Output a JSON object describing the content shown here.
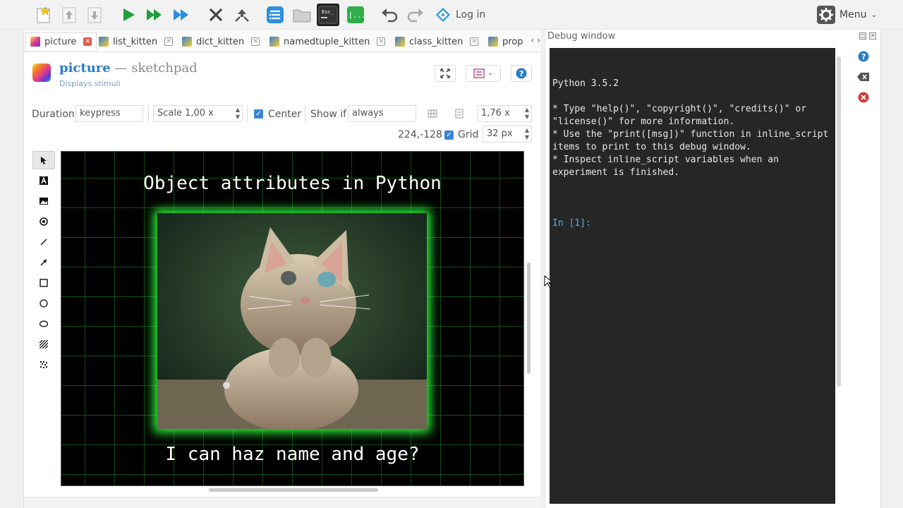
{
  "toolbar": {
    "login_label": "Log in",
    "menu_label": "Menu",
    "console_icon_text": "Esc_",
    "var_icon_text": "[...]"
  },
  "tabs": [
    {
      "label": "picture",
      "active": true
    },
    {
      "label": "list_kitten"
    },
    {
      "label": "dict_kitten"
    },
    {
      "label": "namedtuple_kitten"
    },
    {
      "label": "class_kitten"
    },
    {
      "label": "prop"
    }
  ],
  "item": {
    "name": "picture",
    "separator": "—",
    "type": "sketchpad",
    "description": "Displays stimuli"
  },
  "controls": {
    "duration_label": "Duration",
    "duration_value": "keypress",
    "scale_value": "Scale 1,00 x",
    "center_label": "Center",
    "show_if_label": "Show if",
    "show_if_value": "always",
    "zoom_value": "1,76 x",
    "cursor_pos": "224,-128",
    "grid_label": "Grid",
    "grid_value": "32 px"
  },
  "canvas": {
    "title": "Object attributes in Python",
    "caption": "I can haz name and age?",
    "background": "#000000",
    "grid_color": "#1f7a22",
    "frame_glow": "#2cff3c"
  },
  "debug": {
    "title": "Debug window",
    "lines": [
      "Python 3.5.2",
      "",
      "* Type \"help()\", \"copyright()\", \"credits()\" or \"license()\" for more information.",
      "* Use the \"print([msg])\" function in inline_script items to print to this debug window.",
      "* Inspect inline_script variables when an experiment is finished.",
      ""
    ],
    "prompt": "In [1]:"
  },
  "colors": {
    "accent": "#2a7cc7",
    "play_green": "#1f9e3a",
    "console_bg": "#262626"
  }
}
